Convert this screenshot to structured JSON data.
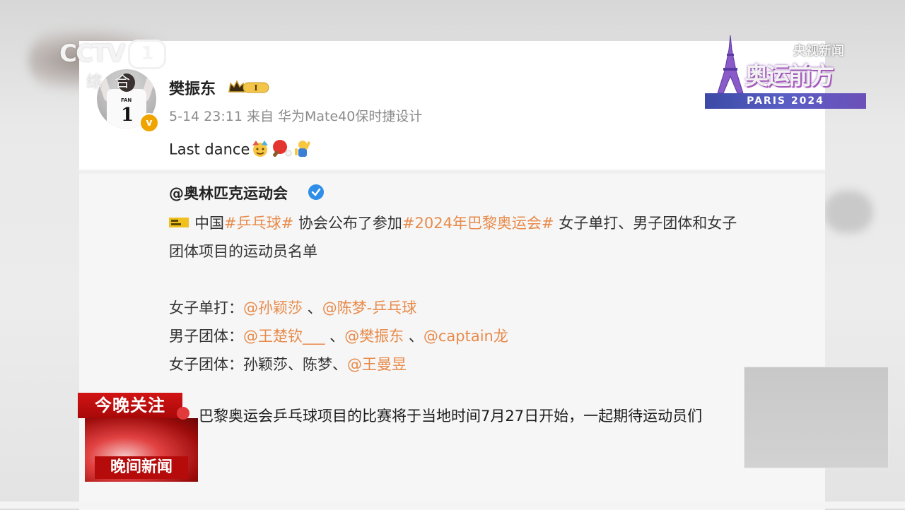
{
  "channel": {
    "logo_text": "CCTV",
    "number": "1",
    "sub": "综合"
  },
  "event_logo": {
    "cctv_label": "央视新闻",
    "title": "奥运前方",
    "band": "PARIS 2024"
  },
  "post": {
    "username": "樊振东",
    "badge": "I",
    "jersey_name": "FAN",
    "jersey_number": "1",
    "meta": "5-14 23:11  来自 华为Mate40保时捷设计",
    "text": "Last dance",
    "emojis": [
      "celebrate-emoji",
      "ping-pong-emoji",
      "cheer-emoji"
    ]
  },
  "repost": {
    "username": "@奥林匹克运动会",
    "line1": {
      "prefix": "中国",
      "tag1": "#乒乓球#",
      "mid": " 协会公布了参加",
      "tag2": "#2024年巴黎奥运会#",
      "suffix": " 女子单打、男子团体和女子"
    },
    "line2": "团体项目的运动员名单",
    "womens_singles": {
      "label": "女子单打：",
      "m1": "@孙颖莎",
      "sep": " 、",
      "m2": "@陈梦-乒乓球"
    },
    "mens_team": {
      "label": "男子团体：",
      "m1": "@王楚钦___",
      "sep1": " 、",
      "m2": "@樊振东",
      "sep2": " 、",
      "m3": "@captain龙"
    },
    "womens_team": {
      "label": "女子团体：",
      "plain": "孙颖莎、陈梦、",
      "m1": "@王曼昱"
    }
  },
  "lower_third": {
    "top_label": "今晚关注",
    "bottom_label": "晚间新闻",
    "headline": "巴黎奥运会乒乓球项目的比赛将于当地时间7月27日开始，一起期待运动员们"
  },
  "colors": {
    "accent": "#e88a4a",
    "verified_blue": "#2f8fe8",
    "lower_third_red": "#c40f0f"
  }
}
